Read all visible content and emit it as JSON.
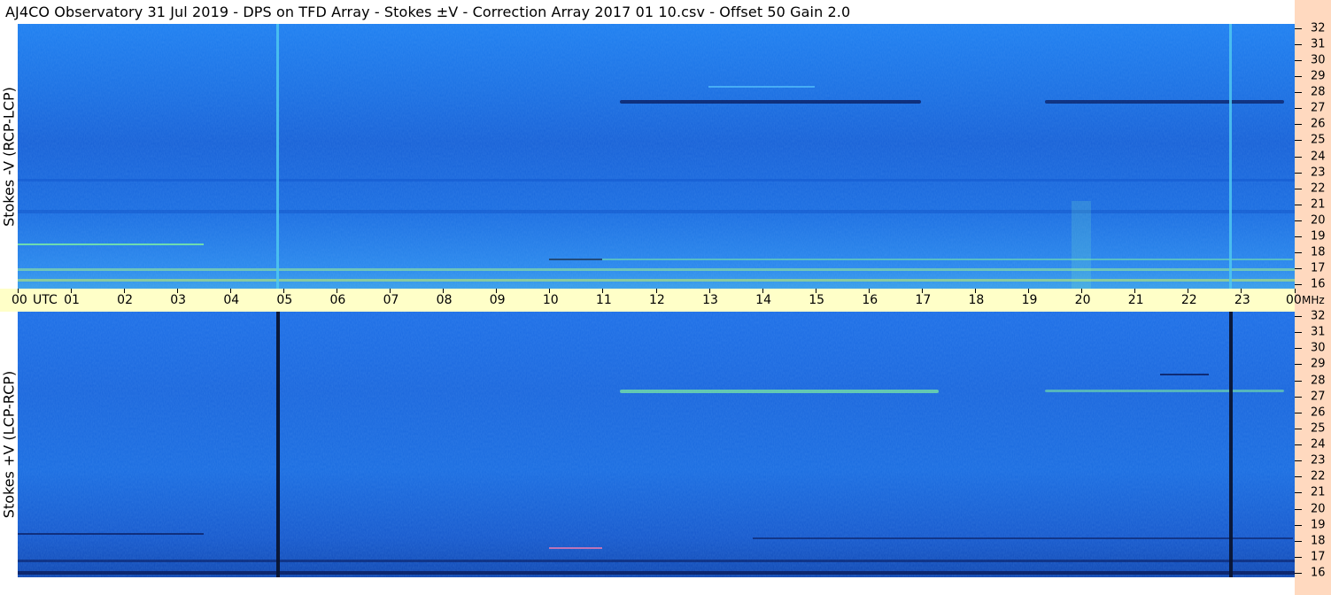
{
  "header": {
    "title": "AJ4CO Observatory  31 Jul 2019  -  DPS on TFD Array  -  Stokes ±V  -  Correction Array 2017 01 10.csv  -  Offset 50  Gain 2.0"
  },
  "panels": {
    "top_label": "Stokes -V (RCP-LCP)",
    "bottom_label": "Stokes +V (LCP-RCP)"
  },
  "time_axis": {
    "hours": [
      "00",
      "01",
      "02",
      "03",
      "04",
      "05",
      "06",
      "07",
      "08",
      "09",
      "10",
      "11",
      "12",
      "13",
      "14",
      "15",
      "16",
      "17",
      "18",
      "19",
      "20",
      "21",
      "22",
      "23",
      "00"
    ],
    "utc_label": "UTC",
    "unit_label": "MHz"
  },
  "freq_axis": {
    "labels": [
      "32",
      "31",
      "30",
      "29",
      "28",
      "27",
      "26",
      "25",
      "24",
      "23",
      "22",
      "21",
      "20",
      "19",
      "18",
      "17",
      "16"
    ],
    "min_mhz": 16,
    "max_mhz": 32
  },
  "colors": {
    "spectrogram_base": "#1e72e6",
    "axis_strip": "#ffffc8",
    "freq_strip": "#ffd9bf",
    "event_bright": "#7ff0a0",
    "event_dark": "#0a1a5a"
  }
}
